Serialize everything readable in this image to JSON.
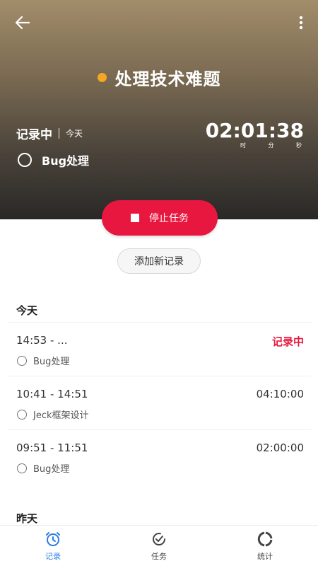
{
  "header": {
    "task_title": "处理技术难题",
    "status": "记录中",
    "day": "今天",
    "timer": "02:01:38",
    "timer_units": {
      "hour": "时",
      "minute": "分",
      "second": "秒"
    },
    "current_task": "Bug处理"
  },
  "actions": {
    "stop_label": "停止任务",
    "add_label": "添加新记录"
  },
  "sections": {
    "today": "今天",
    "yesterday": "昨天"
  },
  "records": [
    {
      "time": "14:53 - ...",
      "duration": "记录中",
      "task": "Bug处理"
    },
    {
      "time": "10:41 - 14:51",
      "duration": "04:10:00",
      "task": "Jeck框架设计"
    },
    {
      "time": "09:51 - 11:51",
      "duration": "02:00:00",
      "task": "Bug处理"
    }
  ],
  "tabs": [
    {
      "label": "记录",
      "icon": "alarm-clock-icon",
      "active": true
    },
    {
      "label": "任务",
      "icon": "check-circle-icon",
      "active": false
    },
    {
      "label": "统计",
      "icon": "donut-chart-icon",
      "active": false
    }
  ],
  "colors": {
    "accent_red": "#e8173f",
    "task_dot": "#f5a623",
    "tab_active": "#2a7de1"
  }
}
